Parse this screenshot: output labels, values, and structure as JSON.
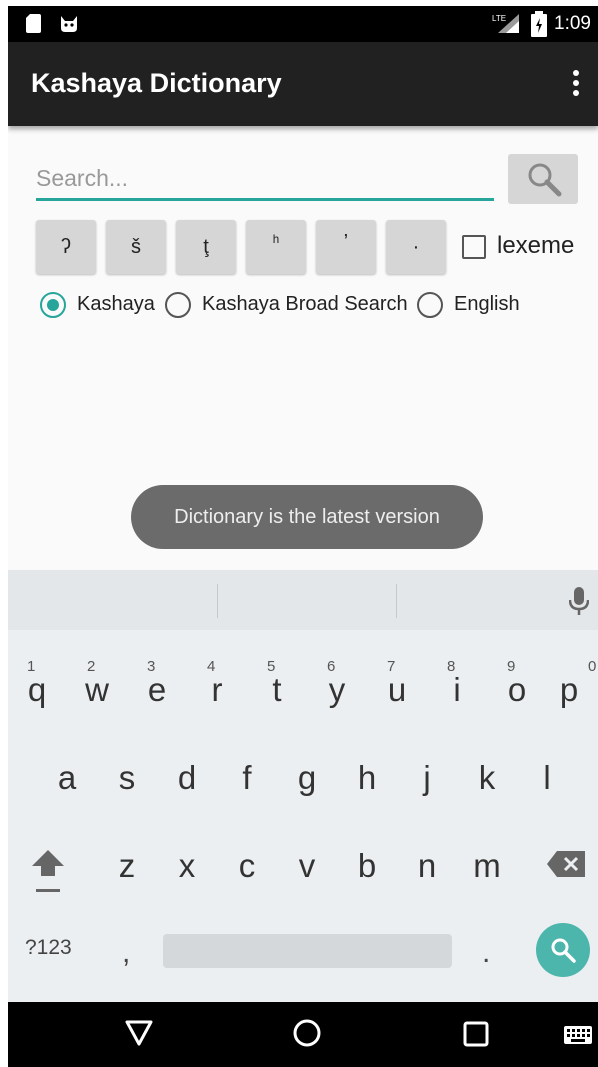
{
  "status_bar": {
    "time": "1:09",
    "network_label": "LTE"
  },
  "app_bar": {
    "title": "Kashaya Dictionary"
  },
  "search": {
    "placeholder": "Search..."
  },
  "char_buttons": [
    "ʔ",
    "š",
    "ţ",
    "ʰ",
    "ʼ",
    "·"
  ],
  "lexeme_label": "lexeme",
  "radio_options": [
    {
      "label": "Kashaya",
      "selected": true
    },
    {
      "label": "Kashaya Broad Search",
      "selected": false
    },
    {
      "label": "English",
      "selected": false
    }
  ],
  "toast": "Dictionary is the latest version",
  "keyboard": {
    "row1": [
      {
        "ch": "q",
        "hint": "1"
      },
      {
        "ch": "w",
        "hint": "2"
      },
      {
        "ch": "e",
        "hint": "3"
      },
      {
        "ch": "r",
        "hint": "4"
      },
      {
        "ch": "t",
        "hint": "5"
      },
      {
        "ch": "y",
        "hint": "6"
      },
      {
        "ch": "u",
        "hint": "7"
      },
      {
        "ch": "i",
        "hint": "8"
      },
      {
        "ch": "o",
        "hint": "9"
      },
      {
        "ch": "p",
        "hint": "0"
      }
    ],
    "row2": [
      "a",
      "s",
      "d",
      "f",
      "g",
      "h",
      "j",
      "k",
      "l"
    ],
    "row3": [
      "z",
      "x",
      "c",
      "v",
      "b",
      "n",
      "m"
    ],
    "symbols_label": "?123",
    "comma": ",",
    "period": "."
  },
  "colors": {
    "accent": "#26a69a",
    "app_bar": "#212121",
    "toast": "#6b6b6b",
    "search_fab": "#4db6ac"
  }
}
